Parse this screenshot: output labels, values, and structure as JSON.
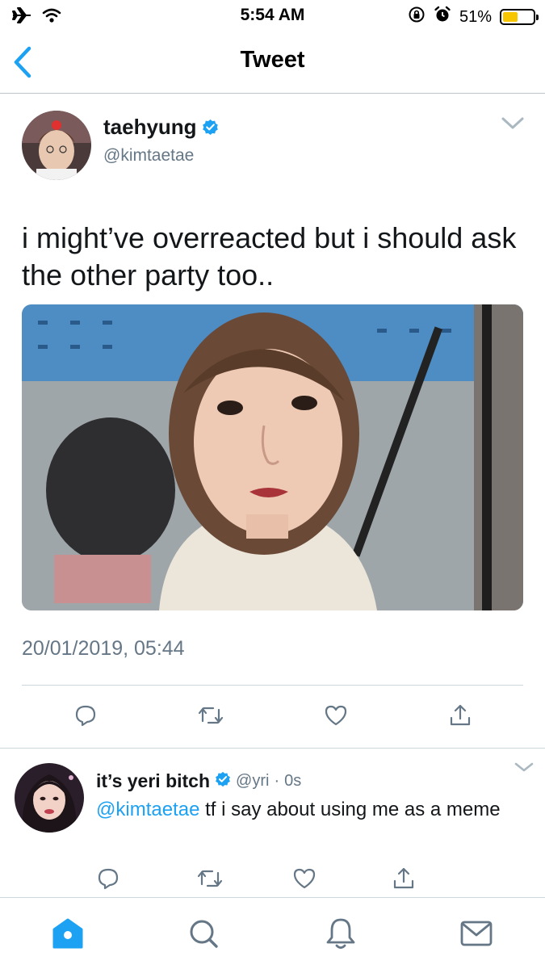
{
  "status_bar": {
    "time": "5:54 AM",
    "battery_percent": "51%",
    "battery_level": 0.51,
    "icons": [
      "airplane-icon",
      "wifi-icon",
      "orientation-lock-icon",
      "alarm-icon",
      "battery-icon"
    ]
  },
  "nav": {
    "title": "Tweet",
    "back_icon": "chevron-left-icon"
  },
  "tweet": {
    "author_name": "taehyung",
    "author_handle": "@kimtaetae",
    "verified": true,
    "text": "i might’ve overreacted but i should ask the other party too..",
    "timestamp": "20/01/2019, 05:44",
    "actions": [
      "reply-icon",
      "retweet-icon",
      "like-icon",
      "share-icon"
    ]
  },
  "reply": {
    "author_name": "it’s yeri bitch",
    "author_handle": "@yri",
    "separator": "·",
    "time": "0s",
    "verified": true,
    "mention": "@kimtaetae",
    "text": "tf i say about using me as a meme",
    "actions": [
      "reply-icon",
      "retweet-icon",
      "like-icon",
      "share-icon"
    ]
  },
  "tabbar": {
    "items": [
      "home-icon",
      "search-icon",
      "notifications-icon",
      "messages-icon"
    ]
  },
  "colors": {
    "accent": "#1da1f2",
    "text": "#14171a",
    "secondary": "#657786",
    "divider": "#ccd6dd",
    "battery": "#f7c600"
  }
}
